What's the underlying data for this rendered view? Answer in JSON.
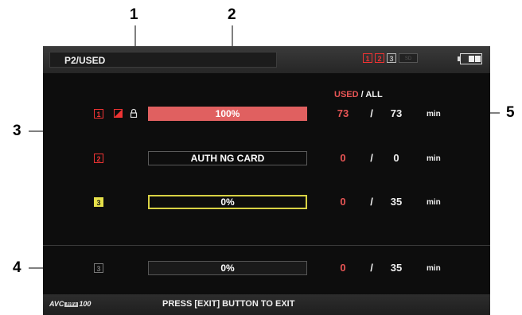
{
  "callouts": [
    "1",
    "2",
    "3",
    "4",
    "5"
  ],
  "screen": {
    "title": "P2/USED",
    "header_slots": [
      "1",
      "2",
      "3",
      "SD"
    ],
    "columns": {
      "used": "USED",
      "separator": "/",
      "all": "ALL"
    },
    "rows": [
      {
        "slot": "1",
        "bar_text": "100%",
        "used": "73",
        "sep": "/",
        "all": "73",
        "unit": "min"
      },
      {
        "slot": "2",
        "bar_text": "AUTH NG CARD",
        "used": "0",
        "sep": "/",
        "all": "0",
        "unit": "min"
      },
      {
        "slot": "3",
        "bar_text": "0%",
        "used": "0",
        "sep": "/",
        "all": "35",
        "unit": "min"
      },
      {
        "slot": "3",
        "bar_text": "0%",
        "used": "0",
        "sep": "/",
        "all": "35",
        "unit": "min"
      }
    ],
    "footer": {
      "logo_avc": "AVC",
      "logo_intra": "Intra",
      "logo_num": "100",
      "exit_message": "PRESS [EXIT] BUTTON TO EXIT"
    },
    "usage_percent": [
      100,
      null,
      0,
      0
    ],
    "colors": {
      "used_red": "#e85555",
      "full_bar": "#e06060",
      "selected_yellow": "#d8d244",
      "background": "#0d0d0d"
    }
  }
}
